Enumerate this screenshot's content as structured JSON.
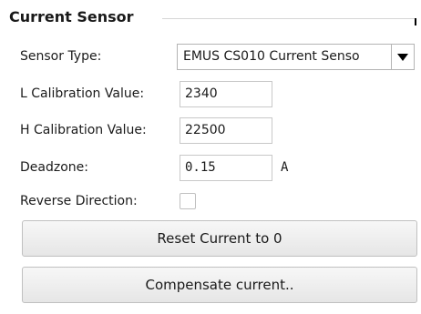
{
  "group": {
    "title": "Current Sensor"
  },
  "sensor_type": {
    "label": "Sensor Type:",
    "selected": "EMUS CS010 Current Senso",
    "dropdown_icon": "triangle-down-icon"
  },
  "l_calibration": {
    "label": "L Calibration Value:",
    "value": "2340"
  },
  "h_calibration": {
    "label": "H  Calibration Value:",
    "value": "22500"
  },
  "deadzone": {
    "label": "Deadzone:",
    "value": "0.15",
    "unit": "A"
  },
  "reverse_direction": {
    "label": "Reverse Direction:",
    "checked": false
  },
  "buttons": {
    "reset_label": "Reset Current to 0",
    "compensate_label": "Compensate current.."
  }
}
